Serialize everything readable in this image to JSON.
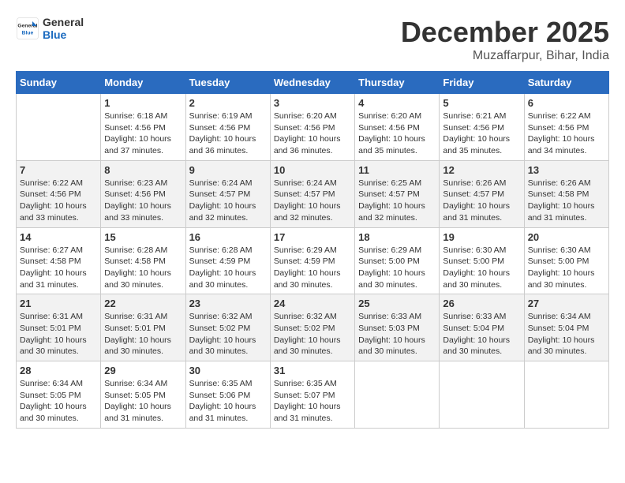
{
  "logo": {
    "line1": "General",
    "line2": "Blue"
  },
  "header": {
    "month": "December 2025",
    "location": "Muzaffarpur, Bihar, India"
  },
  "days_of_week": [
    "Sunday",
    "Monday",
    "Tuesday",
    "Wednesday",
    "Thursday",
    "Friday",
    "Saturday"
  ],
  "weeks": [
    [
      {
        "day": "",
        "sunrise": "",
        "sunset": "",
        "daylight": ""
      },
      {
        "day": "1",
        "sunrise": "Sunrise: 6:18 AM",
        "sunset": "Sunset: 4:56 PM",
        "daylight": "Daylight: 10 hours and 37 minutes."
      },
      {
        "day": "2",
        "sunrise": "Sunrise: 6:19 AM",
        "sunset": "Sunset: 4:56 PM",
        "daylight": "Daylight: 10 hours and 36 minutes."
      },
      {
        "day": "3",
        "sunrise": "Sunrise: 6:20 AM",
        "sunset": "Sunset: 4:56 PM",
        "daylight": "Daylight: 10 hours and 36 minutes."
      },
      {
        "day": "4",
        "sunrise": "Sunrise: 6:20 AM",
        "sunset": "Sunset: 4:56 PM",
        "daylight": "Daylight: 10 hours and 35 minutes."
      },
      {
        "day": "5",
        "sunrise": "Sunrise: 6:21 AM",
        "sunset": "Sunset: 4:56 PM",
        "daylight": "Daylight: 10 hours and 35 minutes."
      },
      {
        "day": "6",
        "sunrise": "Sunrise: 6:22 AM",
        "sunset": "Sunset: 4:56 PM",
        "daylight": "Daylight: 10 hours and 34 minutes."
      }
    ],
    [
      {
        "day": "7",
        "sunrise": "Sunrise: 6:22 AM",
        "sunset": "Sunset: 4:56 PM",
        "daylight": "Daylight: 10 hours and 33 minutes."
      },
      {
        "day": "8",
        "sunrise": "Sunrise: 6:23 AM",
        "sunset": "Sunset: 4:56 PM",
        "daylight": "Daylight: 10 hours and 33 minutes."
      },
      {
        "day": "9",
        "sunrise": "Sunrise: 6:24 AM",
        "sunset": "Sunset: 4:57 PM",
        "daylight": "Daylight: 10 hours and 32 minutes."
      },
      {
        "day": "10",
        "sunrise": "Sunrise: 6:24 AM",
        "sunset": "Sunset: 4:57 PM",
        "daylight": "Daylight: 10 hours and 32 minutes."
      },
      {
        "day": "11",
        "sunrise": "Sunrise: 6:25 AM",
        "sunset": "Sunset: 4:57 PM",
        "daylight": "Daylight: 10 hours and 32 minutes."
      },
      {
        "day": "12",
        "sunrise": "Sunrise: 6:26 AM",
        "sunset": "Sunset: 4:57 PM",
        "daylight": "Daylight: 10 hours and 31 minutes."
      },
      {
        "day": "13",
        "sunrise": "Sunrise: 6:26 AM",
        "sunset": "Sunset: 4:58 PM",
        "daylight": "Daylight: 10 hours and 31 minutes."
      }
    ],
    [
      {
        "day": "14",
        "sunrise": "Sunrise: 6:27 AM",
        "sunset": "Sunset: 4:58 PM",
        "daylight": "Daylight: 10 hours and 31 minutes."
      },
      {
        "day": "15",
        "sunrise": "Sunrise: 6:28 AM",
        "sunset": "Sunset: 4:58 PM",
        "daylight": "Daylight: 10 hours and 30 minutes."
      },
      {
        "day": "16",
        "sunrise": "Sunrise: 6:28 AM",
        "sunset": "Sunset: 4:59 PM",
        "daylight": "Daylight: 10 hours and 30 minutes."
      },
      {
        "day": "17",
        "sunrise": "Sunrise: 6:29 AM",
        "sunset": "Sunset: 4:59 PM",
        "daylight": "Daylight: 10 hours and 30 minutes."
      },
      {
        "day": "18",
        "sunrise": "Sunrise: 6:29 AM",
        "sunset": "Sunset: 5:00 PM",
        "daylight": "Daylight: 10 hours and 30 minutes."
      },
      {
        "day": "19",
        "sunrise": "Sunrise: 6:30 AM",
        "sunset": "Sunset: 5:00 PM",
        "daylight": "Daylight: 10 hours and 30 minutes."
      },
      {
        "day": "20",
        "sunrise": "Sunrise: 6:30 AM",
        "sunset": "Sunset: 5:00 PM",
        "daylight": "Daylight: 10 hours and 30 minutes."
      }
    ],
    [
      {
        "day": "21",
        "sunrise": "Sunrise: 6:31 AM",
        "sunset": "Sunset: 5:01 PM",
        "daylight": "Daylight: 10 hours and 30 minutes."
      },
      {
        "day": "22",
        "sunrise": "Sunrise: 6:31 AM",
        "sunset": "Sunset: 5:01 PM",
        "daylight": "Daylight: 10 hours and 30 minutes."
      },
      {
        "day": "23",
        "sunrise": "Sunrise: 6:32 AM",
        "sunset": "Sunset: 5:02 PM",
        "daylight": "Daylight: 10 hours and 30 minutes."
      },
      {
        "day": "24",
        "sunrise": "Sunrise: 6:32 AM",
        "sunset": "Sunset: 5:02 PM",
        "daylight": "Daylight: 10 hours and 30 minutes."
      },
      {
        "day": "25",
        "sunrise": "Sunrise: 6:33 AM",
        "sunset": "Sunset: 5:03 PM",
        "daylight": "Daylight: 10 hours and 30 minutes."
      },
      {
        "day": "26",
        "sunrise": "Sunrise: 6:33 AM",
        "sunset": "Sunset: 5:04 PM",
        "daylight": "Daylight: 10 hours and 30 minutes."
      },
      {
        "day": "27",
        "sunrise": "Sunrise: 6:34 AM",
        "sunset": "Sunset: 5:04 PM",
        "daylight": "Daylight: 10 hours and 30 minutes."
      }
    ],
    [
      {
        "day": "28",
        "sunrise": "Sunrise: 6:34 AM",
        "sunset": "Sunset: 5:05 PM",
        "daylight": "Daylight: 10 hours and 30 minutes."
      },
      {
        "day": "29",
        "sunrise": "Sunrise: 6:34 AM",
        "sunset": "Sunset: 5:05 PM",
        "daylight": "Daylight: 10 hours and 31 minutes."
      },
      {
        "day": "30",
        "sunrise": "Sunrise: 6:35 AM",
        "sunset": "Sunset: 5:06 PM",
        "daylight": "Daylight: 10 hours and 31 minutes."
      },
      {
        "day": "31",
        "sunrise": "Sunrise: 6:35 AM",
        "sunset": "Sunset: 5:07 PM",
        "daylight": "Daylight: 10 hours and 31 minutes."
      },
      {
        "day": "",
        "sunrise": "",
        "sunset": "",
        "daylight": ""
      },
      {
        "day": "",
        "sunrise": "",
        "sunset": "",
        "daylight": ""
      },
      {
        "day": "",
        "sunrise": "",
        "sunset": "",
        "daylight": ""
      }
    ]
  ]
}
